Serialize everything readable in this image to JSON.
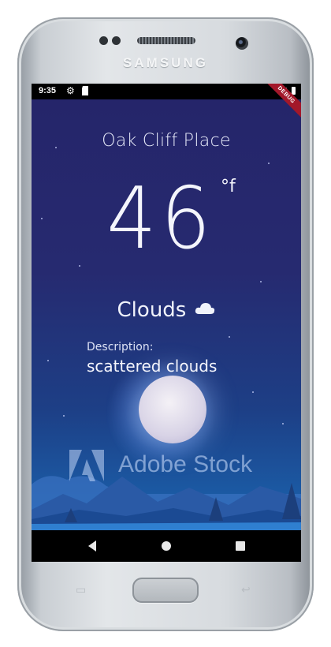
{
  "device": {
    "brand": "SAMSUNG"
  },
  "status_bar": {
    "time": "9:35",
    "icons": [
      "gear-icon",
      "sd-card-icon",
      "wifi-icon",
      "battery-icon"
    ]
  },
  "debug_banner": "DEBUG",
  "weather": {
    "city": "Oak Cliff Place",
    "temperature": "46",
    "unit": "°f",
    "condition": "Clouds",
    "condition_icon": "cloud-icon",
    "description_label": "Description:",
    "description": "scattered clouds"
  },
  "watermark": {
    "text": "Adobe Stock"
  },
  "nav_bar": {
    "buttons": [
      "back-icon",
      "home-icon",
      "recent-apps-icon"
    ]
  },
  "colors": {
    "sky_top": "#25256a",
    "sky_bottom": "#1a65b0",
    "text": "#f4f5fc",
    "debug": "#a3182a"
  }
}
